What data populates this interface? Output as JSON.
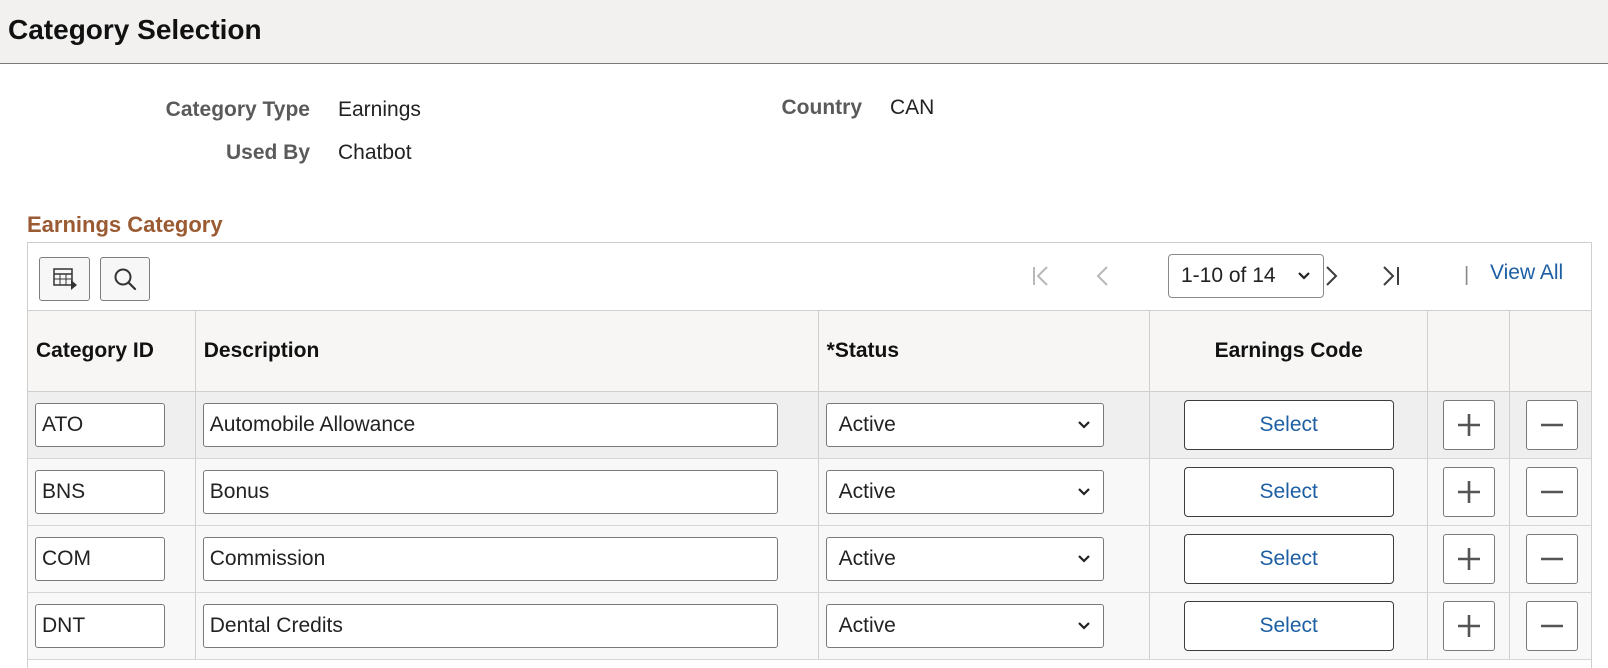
{
  "page": {
    "title": "Category Selection"
  },
  "info": {
    "category_type_label": "Category Type",
    "category_type_value": "Earnings",
    "used_by_label": "Used By",
    "used_by_value": "Chatbot",
    "country_label": "Country",
    "country_value": "CAN"
  },
  "grid": {
    "title": "Earnings Category",
    "pager": {
      "range": "1-10 of 14"
    },
    "view_all": "View All",
    "columns": {
      "category_id": "Category ID",
      "description": "Description",
      "status": "*Status",
      "earnings_code": "Earnings Code"
    },
    "select_label": "Select",
    "rows": [
      {
        "id": "ATO",
        "description": "Automobile Allowance",
        "status": "Active"
      },
      {
        "id": "BNS",
        "description": "Bonus",
        "status": "Active"
      },
      {
        "id": "COM",
        "description": "Commission",
        "status": "Active"
      },
      {
        "id": "DNT",
        "description": "Dental Credits",
        "status": "Active"
      }
    ]
  },
  "colors": {
    "accent": "#9a5a32",
    "link": "#1d5fa3",
    "header_bg": "#f2f1f0"
  },
  "icons": [
    "grid-personalize-icon",
    "search-icon",
    "first-page-icon",
    "previous-page-icon",
    "next-page-icon",
    "last-page-icon",
    "chevron-down-icon",
    "plus-icon",
    "minus-icon"
  ]
}
